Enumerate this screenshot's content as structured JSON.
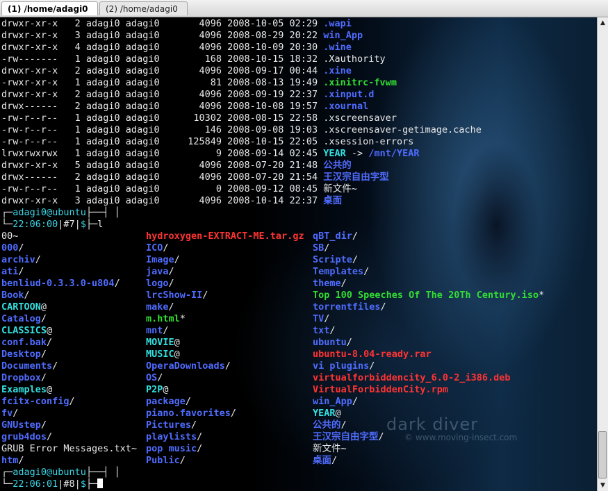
{
  "tabs": [
    {
      "label": "(1) /home/adagi0"
    },
    {
      "label": "(2) /home/adagi0"
    }
  ],
  "listing": [
    {
      "perm": "drwxr-xr-x",
      "links": "2",
      "owner": "adagi0",
      "group": "adagi0",
      "size": "4096",
      "date": "2008-10-05",
      "time": "02:29",
      "name": "wapi",
      "type": "dir",
      "dot": true
    },
    {
      "perm": "drwxr-xr-x",
      "links": "3",
      "owner": "adagi0",
      "group": "adagi0",
      "size": "4096",
      "date": "2008-08-29",
      "time": "20:22",
      "name": "win_App",
      "type": "dir",
      "dot": false
    },
    {
      "perm": "drwxr-xr-x",
      "links": "4",
      "owner": "adagi0",
      "group": "adagi0",
      "size": "4096",
      "date": "2008-10-09",
      "time": "20:30",
      "name": "wine",
      "type": "dir",
      "dot": true
    },
    {
      "perm": "-rw-------",
      "links": "1",
      "owner": "adagi0",
      "group": "adagi0",
      "size": "168",
      "date": "2008-10-15",
      "time": "18:32",
      "name": ".Xauthority",
      "type": "file",
      "dot": false
    },
    {
      "perm": "drwxr-xr-x",
      "links": "2",
      "owner": "adagi0",
      "group": "adagi0",
      "size": "4096",
      "date": "2008-09-17",
      "time": "00:44",
      "name": "xine",
      "type": "dir",
      "dot": true
    },
    {
      "perm": "-rwxr-xr-x",
      "links": "1",
      "owner": "adagi0",
      "group": "adagi0",
      "size": "81",
      "date": "2008-08-13",
      "time": "19:49",
      "name": "xinitrc-fvwm",
      "type": "exec",
      "dot": true
    },
    {
      "perm": "drwxr-xr-x",
      "links": "2",
      "owner": "adagi0",
      "group": "adagi0",
      "size": "4096",
      "date": "2008-09-19",
      "time": "22:37",
      "name": "xinput.d",
      "type": "dir",
      "dot": true
    },
    {
      "perm": "drwx------",
      "links": "2",
      "owner": "adagi0",
      "group": "adagi0",
      "size": "4096",
      "date": "2008-10-08",
      "time": "19:57",
      "name": "xournal",
      "type": "dir",
      "dot": true
    },
    {
      "perm": "-rw-r--r--",
      "links": "1",
      "owner": "adagi0",
      "group": "adagi0",
      "size": "10302",
      "date": "2008-08-15",
      "time": "22:58",
      "name": ".xscreensaver",
      "type": "file",
      "dot": false
    },
    {
      "perm": "-rw-r--r--",
      "links": "1",
      "owner": "adagi0",
      "group": "adagi0",
      "size": "146",
      "date": "2008-09-08",
      "time": "19:03",
      "name": ".xscreensaver-getimage.cache",
      "type": "file",
      "dot": false
    },
    {
      "perm": "-rw-r--r--",
      "links": "1",
      "owner": "adagi0",
      "group": "adagi0",
      "size": "125849",
      "date": "2008-10-15",
      "time": "22:05",
      "name": ".xsession-errors",
      "type": "file",
      "dot": false
    },
    {
      "perm": "lrwxrwxrwx",
      "links": "1",
      "owner": "adagi0",
      "group": "adagi0",
      "size": "9",
      "date": "2008-09-14",
      "time": "02:45",
      "name": "YEAR",
      "type": "link",
      "dot": false,
      "target": "/mnt/YEAR"
    },
    {
      "perm": "drwxr-xr-x",
      "links": "5",
      "owner": "adagi0",
      "group": "adagi0",
      "size": "4096",
      "date": "2008-07-20",
      "time": "21:48",
      "name": "公共的",
      "type": "dir",
      "dot": false
    },
    {
      "perm": "drwx------",
      "links": "2",
      "owner": "adagi0",
      "group": "adagi0",
      "size": "4096",
      "date": "2008-07-20",
      "time": "21:54",
      "name": "王汉宗自由字型",
      "type": "dir",
      "dot": false
    },
    {
      "perm": "-rw-r--r--",
      "links": "1",
      "owner": "adagi0",
      "group": "adagi0",
      "size": "0",
      "date": "2008-09-12",
      "time": "08:45",
      "name": "新文件~",
      "type": "file",
      "dot": false
    },
    {
      "perm": "drwxr-xr-x",
      "links": "3",
      "owner": "adagi0",
      "group": "adagi0",
      "size": "4096",
      "date": "2008-10-14",
      "time": "22:37",
      "name": "桌面",
      "type": "dir",
      "dot": false
    }
  ],
  "prompt1": {
    "user": "adagi0@ubuntu",
    "time": "22:06:00",
    "num": "#7",
    "sym": "$",
    "cmd": "l"
  },
  "columns": [
    [
      {
        "name": "00~",
        "type": "file"
      },
      {
        "name": "000",
        "type": "dir"
      },
      {
        "name": "archiv",
        "type": "dir"
      },
      {
        "name": "ati",
        "type": "dir"
      },
      {
        "name": "benliud-0.3.3.0-u804",
        "type": "dir"
      },
      {
        "name": "Book",
        "type": "dir"
      },
      {
        "name": "CARTOON",
        "type": "link"
      },
      {
        "name": "Catalog",
        "type": "dir"
      },
      {
        "name": "CLASSICS",
        "type": "link"
      },
      {
        "name": "conf.bak",
        "type": "dir"
      },
      {
        "name": "Desktop",
        "type": "dir"
      },
      {
        "name": "Documents",
        "type": "dir"
      },
      {
        "name": "Dropbox",
        "type": "dir"
      },
      {
        "name": "Examples",
        "type": "link"
      },
      {
        "name": "fcitx-config",
        "type": "dir"
      },
      {
        "name": "fv",
        "type": "dir"
      },
      {
        "name": "GNUstep",
        "type": "dir"
      },
      {
        "name": "grub4dos",
        "type": "dir"
      },
      {
        "name": "GRUB Error Messages.txt~",
        "type": "file"
      },
      {
        "name": "htm",
        "type": "dir"
      }
    ],
    [
      {
        "name": "hydroxygen-EXTRACT-ME.tar.gz",
        "type": "archive"
      },
      {
        "name": "ICO",
        "type": "dir"
      },
      {
        "name": "Image",
        "type": "dir"
      },
      {
        "name": "java",
        "type": "dir"
      },
      {
        "name": "logo",
        "type": "dir"
      },
      {
        "name": "lrcShow-II",
        "type": "dir"
      },
      {
        "name": "make",
        "type": "dir"
      },
      {
        "name": "m.html",
        "type": "exec"
      },
      {
        "name": "mnt",
        "type": "dir"
      },
      {
        "name": "MOVIE",
        "type": "link"
      },
      {
        "name": "MUSIC",
        "type": "link"
      },
      {
        "name": "OperaDownloads",
        "type": "dir"
      },
      {
        "name": "OS",
        "type": "dir"
      },
      {
        "name": "P2P",
        "type": "link"
      },
      {
        "name": "package",
        "type": "dir"
      },
      {
        "name": "piano.favorites",
        "type": "dir"
      },
      {
        "name": "Pictures",
        "type": "dir"
      },
      {
        "name": "playlists",
        "type": "dir"
      },
      {
        "name": "pop music",
        "type": "dir"
      },
      {
        "name": "Public",
        "type": "dir"
      }
    ],
    [
      {
        "name": "qBT_dir",
        "type": "dir"
      },
      {
        "name": "SB",
        "type": "dir"
      },
      {
        "name": "Scripte",
        "type": "dir"
      },
      {
        "name": "Templates",
        "type": "dir"
      },
      {
        "name": "theme",
        "type": "dir"
      },
      {
        "name": "Top 100 Speeches Of The 20Th Century.iso",
        "type": "exec"
      },
      {
        "name": "torrentfiles",
        "type": "dir"
      },
      {
        "name": "TV",
        "type": "dir"
      },
      {
        "name": "txt",
        "type": "dir"
      },
      {
        "name": "ubuntu",
        "type": "dir"
      },
      {
        "name": "ubuntu-8.04-ready.rar",
        "type": "archive"
      },
      {
        "name": "vi plugins",
        "type": "dir"
      },
      {
        "name": "virtualforbiddencity_6.0-2_i386.deb",
        "type": "archive"
      },
      {
        "name": "VirtualForbiddenCity.rpm",
        "type": "archive"
      },
      {
        "name": "win_App",
        "type": "dir"
      },
      {
        "name": "YEAR",
        "type": "link"
      },
      {
        "name": "公共的",
        "type": "dir"
      },
      {
        "name": "王汉宗自由字型",
        "type": "dir"
      },
      {
        "name": "新文件~",
        "type": "file"
      },
      {
        "name": "桌面",
        "type": "dir"
      }
    ]
  ],
  "prompt2": {
    "user": "adagi0@ubuntu",
    "time": "22:06:01",
    "num": "#8",
    "sym": "$",
    "cmd": ""
  },
  "watermark": {
    "title": "dark diver",
    "url": "© www.moving-insect.com"
  },
  "colors": {
    "dir": "#4f6cff",
    "exec": "#33dd33",
    "link": "#33e0e0",
    "archive": "#ff3333",
    "prompt": "#3ad5e5",
    "text": "#e8e8e8"
  }
}
